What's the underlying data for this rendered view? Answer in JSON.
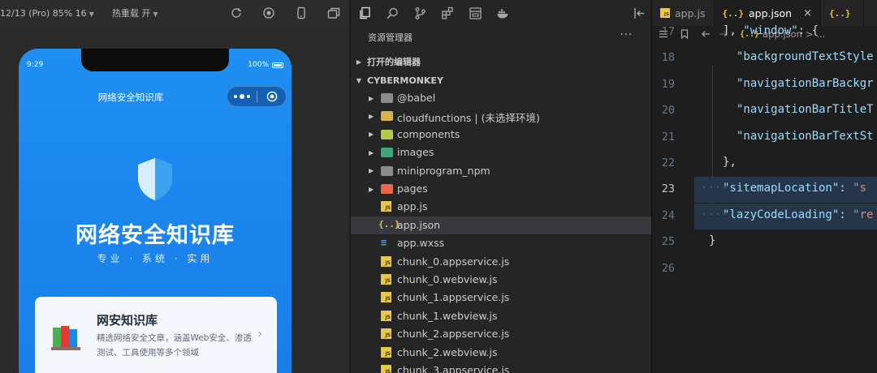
{
  "simulator": {
    "device_label": "12/13 (Pro) 85% 16",
    "hot_reload_label": "热重载 开",
    "tool_icons": [
      "refresh-icon",
      "stop-record-icon",
      "phone-icon",
      "window-icon"
    ],
    "status_time": "9:29",
    "status_battery": "100%",
    "nav_title": "网络安全知识库",
    "hero_title": "网络安全知识库",
    "hero_subtitle": "专业 · 系统 · 实用",
    "card": {
      "title": "网安知识库",
      "desc": "精选网络安全文章，涵盖Web安全、渗透测试、工具使用等多个领域",
      "arrow": "›"
    }
  },
  "explorer": {
    "activity_icons": [
      "files-icon",
      "search-icon",
      "source-control-icon",
      "extensions-icon",
      "preview-icon",
      "docker-icon"
    ],
    "header": "资源管理器",
    "more": "···",
    "open_editors": "打开的编辑器",
    "project": "CYBERMONKEY",
    "items": [
      {
        "label": "@babel",
        "type": "folder",
        "color": "#8c8c8c"
      },
      {
        "label": "cloudfunctions | (未选择环境)",
        "type": "folder",
        "color": "#d8b24a"
      },
      {
        "label": "components",
        "type": "folder",
        "color": "#b5c94a"
      },
      {
        "label": "images",
        "type": "folder",
        "color": "#3fa57a"
      },
      {
        "label": "miniprogram_npm",
        "type": "folder",
        "color": "#8c8c8c"
      },
      {
        "label": "pages",
        "type": "folder",
        "color": "#e8674a"
      },
      {
        "label": "app.js",
        "type": "js"
      },
      {
        "label": "app.json",
        "type": "json",
        "selected": true
      },
      {
        "label": "app.wxss",
        "type": "wxss"
      },
      {
        "label": "chunk_0.appservice.js",
        "type": "js"
      },
      {
        "label": "chunk_0.webview.js",
        "type": "js"
      },
      {
        "label": "chunk_1.appservice.js",
        "type": "js"
      },
      {
        "label": "chunk_1.webview.js",
        "type": "js"
      },
      {
        "label": "chunk_2.appservice.js",
        "type": "js"
      },
      {
        "label": "chunk_2.webview.js",
        "type": "js"
      },
      {
        "label": "chunk_3.appservice.js",
        "type": "js"
      }
    ]
  },
  "editor": {
    "tabs": [
      {
        "label": "app.js",
        "type": "js",
        "active": false
      },
      {
        "label": "app.json",
        "type": "json",
        "active": true,
        "close": "×"
      },
      {
        "label": "",
        "type": "json",
        "active": false
      }
    ],
    "breadcrumb": "app.json",
    "breadcrumb_tail": "> ...",
    "lines": [
      {
        "num": "17",
        "text": "], \"window\": {"
      },
      {
        "num": "18",
        "text": "\"backgroundTextStyle"
      },
      {
        "num": "19",
        "text": "\"navigationBarBackgr"
      },
      {
        "num": "20",
        "text": "\"navigationBarTitleT"
      },
      {
        "num": "21",
        "text": "\"navigationBarTextSt"
      },
      {
        "num": "22",
        "text": "},"
      },
      {
        "num": "23",
        "text": "\"sitemapLocation\": \"s"
      },
      {
        "num": "24",
        "text": "\"lazyCodeLoading\": \"re"
      },
      {
        "num": "25",
        "text": "}"
      },
      {
        "num": "26",
        "text": ""
      }
    ],
    "current_line": "23",
    "colors": {
      "key": "#9cdcfe",
      "string": "#ce9178",
      "highlight": "#26364a"
    }
  }
}
